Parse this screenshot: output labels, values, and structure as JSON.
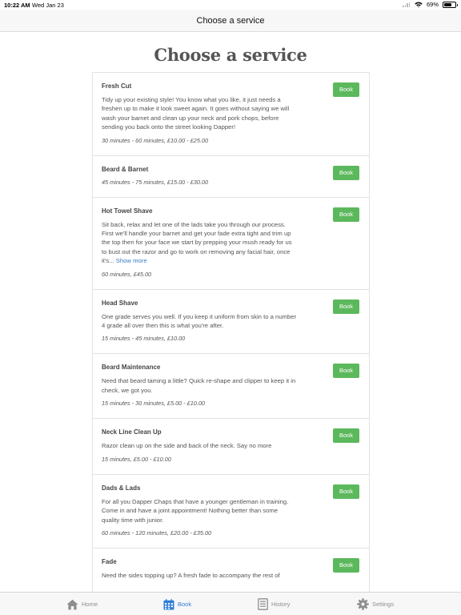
{
  "status_bar": {
    "time": "10:22 AM",
    "date": "Wed Jan 23",
    "battery": "69%",
    "battery_level": 0.69
  },
  "nav": {
    "title": "Choose a service"
  },
  "page": {
    "heading": "Choose a service"
  },
  "services": [
    {
      "name": "Fresh Cut",
      "description": "Tidy up your existing style! You know what you like, it just needs a freshen up to make it look sweet again. It goes without saying we will wash your barnet and clean up your neck and pork chops, before sending you back onto the street looking Dapper!",
      "meta": "30 minutes - 60 minutes, £10.00 - £25.00",
      "button": "Book"
    },
    {
      "name": "Beard & Barnet",
      "description": "",
      "meta": "45 minutes - 75 minutes, £15.00 - £30.00",
      "button": "Book"
    },
    {
      "name": "Hot Towel Shave",
      "description": "Sit back, relax and let one of the lads take you through our process. First we'll handle your barnet and get your fade extra tight and trim up the top then for your face we start by prepping your mush ready for us to bust out the razor and go to work on removing any facial hair, once it's...",
      "show_more": "Show more",
      "meta": "60 minutes, £45.00",
      "button": "Book"
    },
    {
      "name": "Head Shave",
      "description": "One grade serves you well. If you keep it uniform from skin to a number 4 grade all over then this is what you're after.",
      "meta": "15 minutes - 45 minutes, £10.00",
      "button": "Book"
    },
    {
      "name": "Beard Maintenance",
      "description": "Need that beard taming a little? Quick re-shape and clipper to keep it in check, we got you.",
      "meta": "15 minutes - 30 minutes, £5.00 - £10.00",
      "button": "Book"
    },
    {
      "name": "Neck Line Clean Up",
      "description": "Razor clean up on the side and back of the neck. Say no more",
      "meta": "15 minutes, £5.00 - £10.00",
      "button": "Book"
    },
    {
      "name": "Dads & Lads",
      "description": "For all you Dapper Chaps that have a younger gentleman in training. Come in and have a joint appointment! Nothing better than some quality time with junior.",
      "meta": "60 minutes - 120 minutes, £20.00 - £35.00",
      "button": "Book"
    },
    {
      "name": "Fade",
      "description": "Need the sides topping up? A fresh fade to accompany the rest of",
      "meta": "",
      "button": "Book"
    }
  ],
  "tabs": [
    {
      "label": "Home",
      "icon": "home-icon",
      "active": false
    },
    {
      "label": "Book",
      "icon": "calendar-icon",
      "active": true
    },
    {
      "label": "History",
      "icon": "history-icon",
      "active": false
    },
    {
      "label": "Settings",
      "icon": "gear-icon",
      "active": false
    }
  ],
  "colors": {
    "accent": "#2e7fd9",
    "book_button": "#5cb85c",
    "link": "#3a7ec4"
  }
}
